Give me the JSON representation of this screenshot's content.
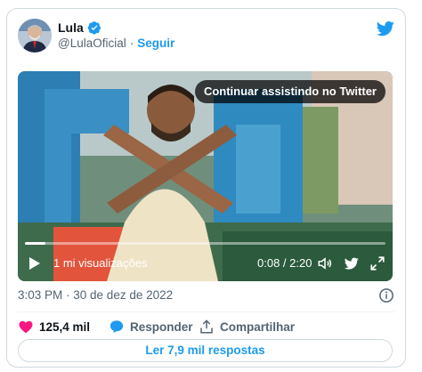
{
  "author": {
    "name": "Lula",
    "handle": "@LulaOficial",
    "separator": "·",
    "follow_label": "Seguir"
  },
  "video": {
    "continue_label": "Continuar assistindo no Twitter",
    "views": "1 mi visualizações",
    "time": "0:08 / 2:20",
    "progress": 0.057
  },
  "timestamp": "3:03 PM · 30 de dez de 2022",
  "actions": {
    "likes": "125,4 mil",
    "reply_label": "Responder",
    "share_label": "Compartilhar"
  },
  "read_replies_label": "Ler 7,9 mil respostas",
  "colors": {
    "accent": "#1d9bf0",
    "like": "#f91880",
    "muted": "#536471"
  },
  "icons": [
    "verified-icon",
    "twitter-bird-icon",
    "play-icon",
    "volume-icon",
    "expand-icon",
    "info-icon",
    "heart-icon",
    "reply-icon",
    "share-icon"
  ]
}
